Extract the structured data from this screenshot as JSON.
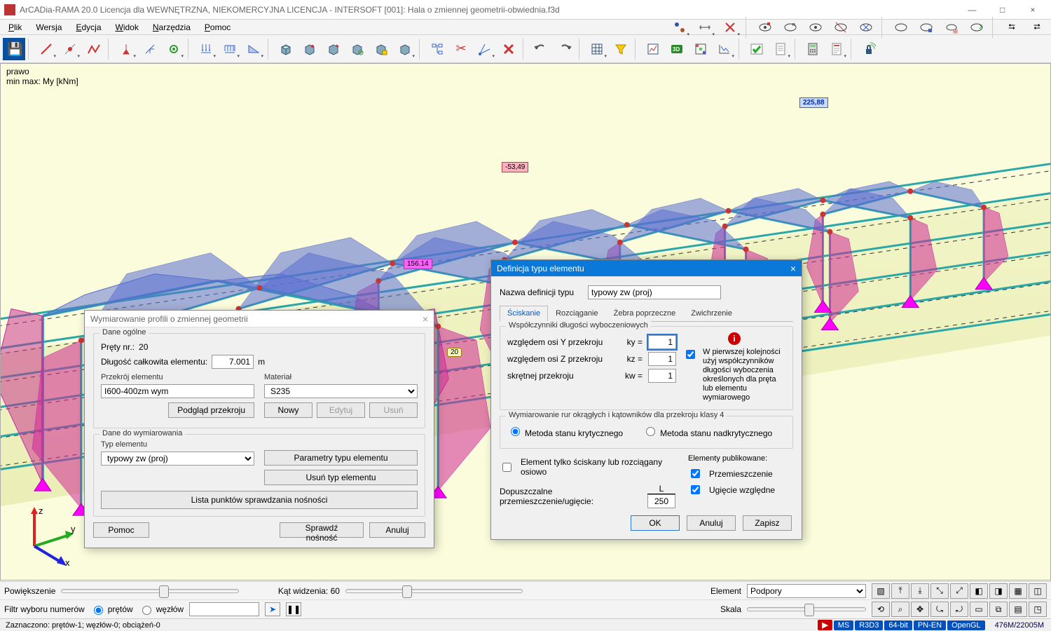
{
  "window": {
    "title": "ArCADia-RAMA 20.0 Licencja dla WEWNĘTRZNA, NIEKOMERCYJNA LICENCJA - INTERSOFT [001]: Hala o zmiennej geometrii-obwiednia.f3d",
    "minimize": "—",
    "maximize": "□",
    "close": "×"
  },
  "menu": {
    "items": [
      "Plik",
      "Wersja",
      "Edycja",
      "Widok",
      "Narzędzia",
      "Pomoc"
    ]
  },
  "viewport": {
    "label1": "prawo",
    "label2": "min max: My [kNm]",
    "tag_neg": "-53,49",
    "tag_pos": "225,88",
    "tag_sel": "156.14",
    "bubble_node": "20"
  },
  "dialog_dim": {
    "title": "Wymiarowanie profili o zmiennej geometrii",
    "close": "×",
    "grp_general": "Dane ogólne",
    "bars_label": "Pręty nr.:",
    "bars_value": "20",
    "len_label": "Długość całkowita elementu:",
    "len_value": "7.001",
    "len_unit": "m",
    "sec_label": "Przekrój elementu",
    "sec_value": "I600-400zm wym",
    "sec_preview": "Podgląd przekroju",
    "mat_label": "Materiał",
    "mat_value": "S235",
    "mat_new": "Nowy",
    "mat_edit": "Edytuj",
    "mat_del": "Usuń",
    "grp_dim": "Dane do wymiarowania",
    "type_label": "Typ elementu",
    "type_value": "typowy zw (proj)",
    "params_btn": "Parametry typu elementu",
    "del_type_btn": "Usuń typ elementu",
    "list_btn": "Lista punktów sprawdzania nośności",
    "help_btn": "Pomoc",
    "check_btn": "Sprawdź nośność",
    "cancel_btn": "Anuluj"
  },
  "dialog_def": {
    "title": "Definicja typu elementu",
    "close": "×",
    "name_label": "Nazwa definicji typu",
    "name_value": "typowy zw (proj)",
    "tabs": [
      "Ściskanie",
      "Rozciąganie",
      "Żebra poprzeczne",
      "Zwichrzenie"
    ],
    "grp_coef": "Współczynniki długości wyboczeniowych",
    "rowY_lbl": "względem osi Y przekroju",
    "rowY_eq": "ky =",
    "rowY_val": "1",
    "rowZ_lbl": "względem osi Z przekroju",
    "rowZ_eq": "kz =",
    "rowZ_val": "1",
    "rowW_lbl": "skrętnej przekroju",
    "rowW_eq": "kw =",
    "rowW_val": "1",
    "info_note": "W pierwszej kolejności użyj współczynników długości wyboczenia określonych dla pręta lub elementu wymiarowego",
    "grp_pipe": "Wymiarowanie rur okrągłych i kątowników dla przekroju klasy 4",
    "radio_crit": "Metoda stanu krytycznego",
    "radio_supercrit": "Metoda stanu nadkrytycznego",
    "chk_axial": "Element tylko ściskany lub rozciągany osiowo",
    "grp_publ": "Elementy publikowane:",
    "disp_label": "Dopuszczalne przemieszczenie/ugięcie:",
    "disp_num": "L",
    "disp_den": "250",
    "chk_disp": "Przemieszczenie",
    "chk_defl": "Ugięcie względne",
    "ok": "OK",
    "cancel": "Anuluj",
    "save": "Zapisz"
  },
  "bottom": {
    "zoom_label": "Powiększenie",
    "fov_label": "Kąt widzenia: 60",
    "element_label": "Element",
    "element_value": "Podpory",
    "scale_label": "Skala",
    "filter_label": "Filtr wyboru numerów",
    "filter_bars": "prętów",
    "filter_nodes": "węzłów"
  },
  "status": {
    "left": "Zaznaczono: prętów-1; węzłów-0; obciążeń-0",
    "badges": [
      "▶",
      "MS",
      "R3D3",
      "64-bit",
      "PN-EN",
      "OpenGL"
    ],
    "mem": "476M/22005M"
  }
}
